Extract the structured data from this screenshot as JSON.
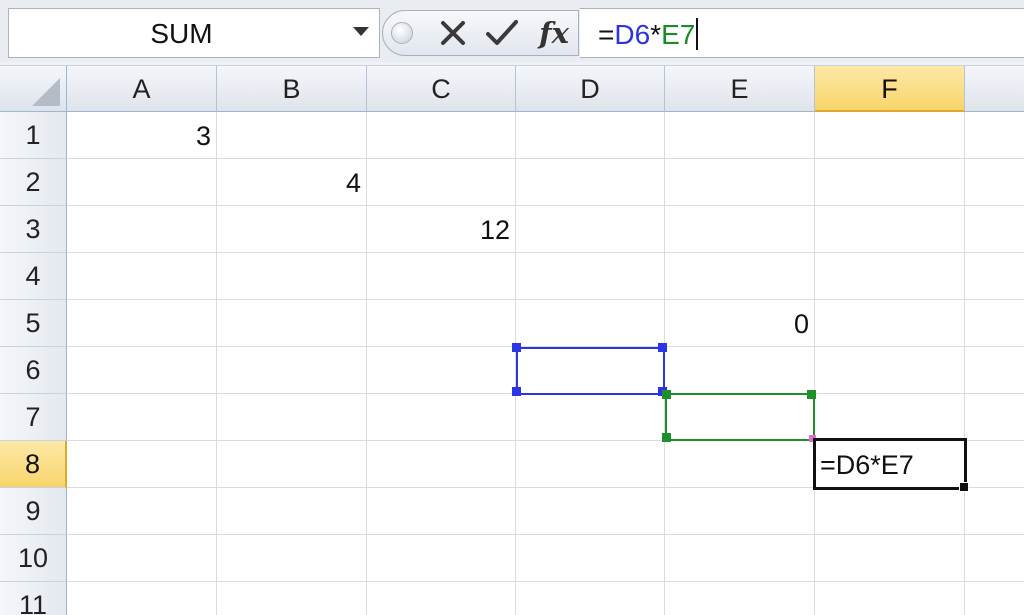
{
  "formula_bar": {
    "name_box": "SUM",
    "formula_prefix": "=",
    "formula_ref1": "D6",
    "formula_operator": "*",
    "formula_ref2": "E7",
    "icons": {
      "cancel": "x-icon",
      "enter": "checkmark-icon",
      "insert_function": "fx-icon",
      "fx_label": "fx"
    }
  },
  "columns": [
    "A",
    "B",
    "C",
    "D",
    "E",
    "F"
  ],
  "active_column": "F",
  "rows": [
    "1",
    "2",
    "3",
    "4",
    "5",
    "6",
    "7",
    "8",
    "9",
    "10",
    "11"
  ],
  "active_row": "8",
  "cells": {
    "A1": "3",
    "B2": "4",
    "C3": "12",
    "E5": "0",
    "F8": "=D6*E7"
  },
  "highlighted_ranges": {
    "D6": {
      "color": "#2b35e4"
    },
    "E7": {
      "color": "#1f8f2c"
    }
  },
  "colors": {
    "ref_blue": "#2c34e0",
    "ref_green": "#1c8a2a",
    "active_header": "#f8d56c"
  }
}
